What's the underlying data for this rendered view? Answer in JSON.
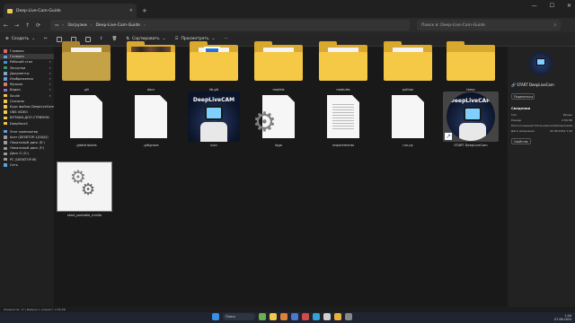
{
  "window": {
    "tab_title": "Deep-Live-Cam-Guide",
    "min": "—",
    "max": "☐",
    "close": "✕"
  },
  "address": {
    "crumb1": "Загрузки",
    "crumb2": "Deep-Live-Cam-Guide",
    "search_placeholder": "Поиск в: Deep-Live-Cam-Guide"
  },
  "toolbar": {
    "create": "Создать",
    "sort": "Сортировать",
    "view": "Просмотреть",
    "details": "Подробнее"
  },
  "sidebar": {
    "items": [
      {
        "label": "Главная",
        "icon": "home-icon",
        "color": "#e06666",
        "pin": false
      },
      {
        "label": "Галерея",
        "icon": "gallery-icon",
        "color": "#5aa0e6",
        "pin": false
      },
      {
        "label": "Рабочий стол",
        "icon": "desktop-icon",
        "color": "#4a8fe0",
        "pin": true
      },
      {
        "label": "Загрузки",
        "icon": "downloads-icon",
        "color": "#2e9e6b",
        "pin": true
      },
      {
        "label": "Документы",
        "icon": "documents-icon",
        "color": "#8aa2c8",
        "pin": true
      },
      {
        "label": "Изображения",
        "icon": "pictures-icon",
        "color": "#5aa0e6",
        "pin": true
      },
      {
        "label": "Музыка",
        "icon": "music-icon",
        "color": "#e07b5a",
        "pin": true
      },
      {
        "label": "Видео",
        "icon": "videos-icon",
        "color": "#9b6ad6",
        "pin": true
      },
      {
        "label": "Soulie",
        "icon": "folder-icon",
        "color": "#f2c94c",
        "pin": true
      },
      {
        "label": "Скачали",
        "icon": "folder-icon",
        "color": "#f2c94c",
        "pin": false
      },
      {
        "label": "Курс файлы DeepLiveCam",
        "icon": "folder-icon",
        "color": "#f2c94c",
        "pin": false
      },
      {
        "label": "OBS VIDEO",
        "icon": "folder-icon",
        "color": "#f2c94c",
        "pin": false
      },
      {
        "label": "BITMAIN-ДОП СТРИМОВ",
        "icon": "folder-icon",
        "color": "#f2c94c",
        "pin": false
      },
      {
        "label": "DeepFace2",
        "icon": "folder-icon",
        "color": "#f2c94c",
        "pin": false
      }
    ],
    "devices": [
      {
        "label": "Этот компьютер",
        "icon": "computer-icon",
        "color": "#5aa0e6"
      },
      {
        "label": "Acer (DESKTOP-1JI1KJG)",
        "icon": "drive-icon",
        "color": "#9a9a9a"
      },
      {
        "label": "Локальный диск (E:)",
        "icon": "drive-icon",
        "color": "#9a9a9a"
      },
      {
        "label": "Локальный диск (F:)",
        "icon": "drive-icon",
        "color": "#9a9a9a"
      },
      {
        "label": "Диск G (G:)",
        "icon": "drive-icon",
        "color": "#9a9a9a"
      },
      {
        "label": "PC (DESKTOP-M)",
        "icon": "drive-icon",
        "color": "#9a9a9a"
      },
      {
        "label": "Сеть",
        "icon": "network-icon",
        "color": "#5aa0e6"
      }
    ]
  },
  "files": {
    "row1": [
      {
        "name": ".git",
        "kind": "folder-muted"
      },
      {
        "name": "docs",
        "kind": "folder-photo"
      },
      {
        "name": "lib.git",
        "kind": "folder-blue"
      },
      {
        "name": "models",
        "kind": "folder-paper"
      },
      {
        "name": "modules",
        "kind": "folder-paper"
      },
      {
        "name": "python",
        "kind": "folder-paper"
      },
      {
        "name": "temp",
        "kind": "folder-empty"
      }
    ],
    "row2": [
      {
        "name": ".gitattributes",
        "kind": "doc"
      },
      {
        "name": ".gitignore",
        "kind": "doc"
      },
      {
        "name": "icon",
        "kind": "poster"
      },
      {
        "name": "logo",
        "kind": "gear-doc"
      },
      {
        "name": "requirements",
        "kind": "doc-lines"
      },
      {
        "name": "run.py",
        "kind": "doc"
      },
      {
        "name": "START DeepLiveCam",
        "kind": "shortcut"
      }
    ],
    "row3": [
      {
        "name": "start_portable_nvidia",
        "kind": "gear"
      }
    ],
    "poster_title": "DeepLiveCAM"
  },
  "details": {
    "name": "START DeepLiveCam",
    "share": "Поделиться",
    "section": "Сведения",
    "rows": [
      {
        "k": "Тип",
        "v": "Ярлык"
      },
      {
        "k": "Размер",
        "v": "2,56 КБ"
      },
      {
        "k": "Расположение",
        "v": "C:\\Пользователи\\Downloads\\..."
      },
      {
        "k": "Дата изменения",
        "v": "05.08.2024 1:40"
      }
    ],
    "open": "Свойства"
  },
  "status": {
    "text": "Элементов: 17  |  Выбран 1 элемент: 2,56 КБ"
  },
  "taskbar": {
    "search": "Поиск",
    "tray_time": "1:44",
    "tray_date": "07.08.2024",
    "apps": [
      {
        "icon": "start-icon",
        "color": "#3b8ee6"
      },
      {
        "icon": "widgets-icon",
        "color": "#6ab04c"
      },
      {
        "icon": "explorer-icon",
        "color": "#f2c94c"
      },
      {
        "icon": "browser-icon",
        "color": "#e0803a"
      },
      {
        "icon": "store-icon",
        "color": "#4a78d0"
      },
      {
        "icon": "mail-icon",
        "color": "#d04a4a"
      },
      {
        "icon": "telegram-icon",
        "color": "#34a0da"
      },
      {
        "icon": "obs-icon",
        "color": "#cfcfcf"
      },
      {
        "icon": "chrome-icon",
        "color": "#e8b23a"
      },
      {
        "icon": "settings-icon",
        "color": "#888888"
      }
    ]
  }
}
